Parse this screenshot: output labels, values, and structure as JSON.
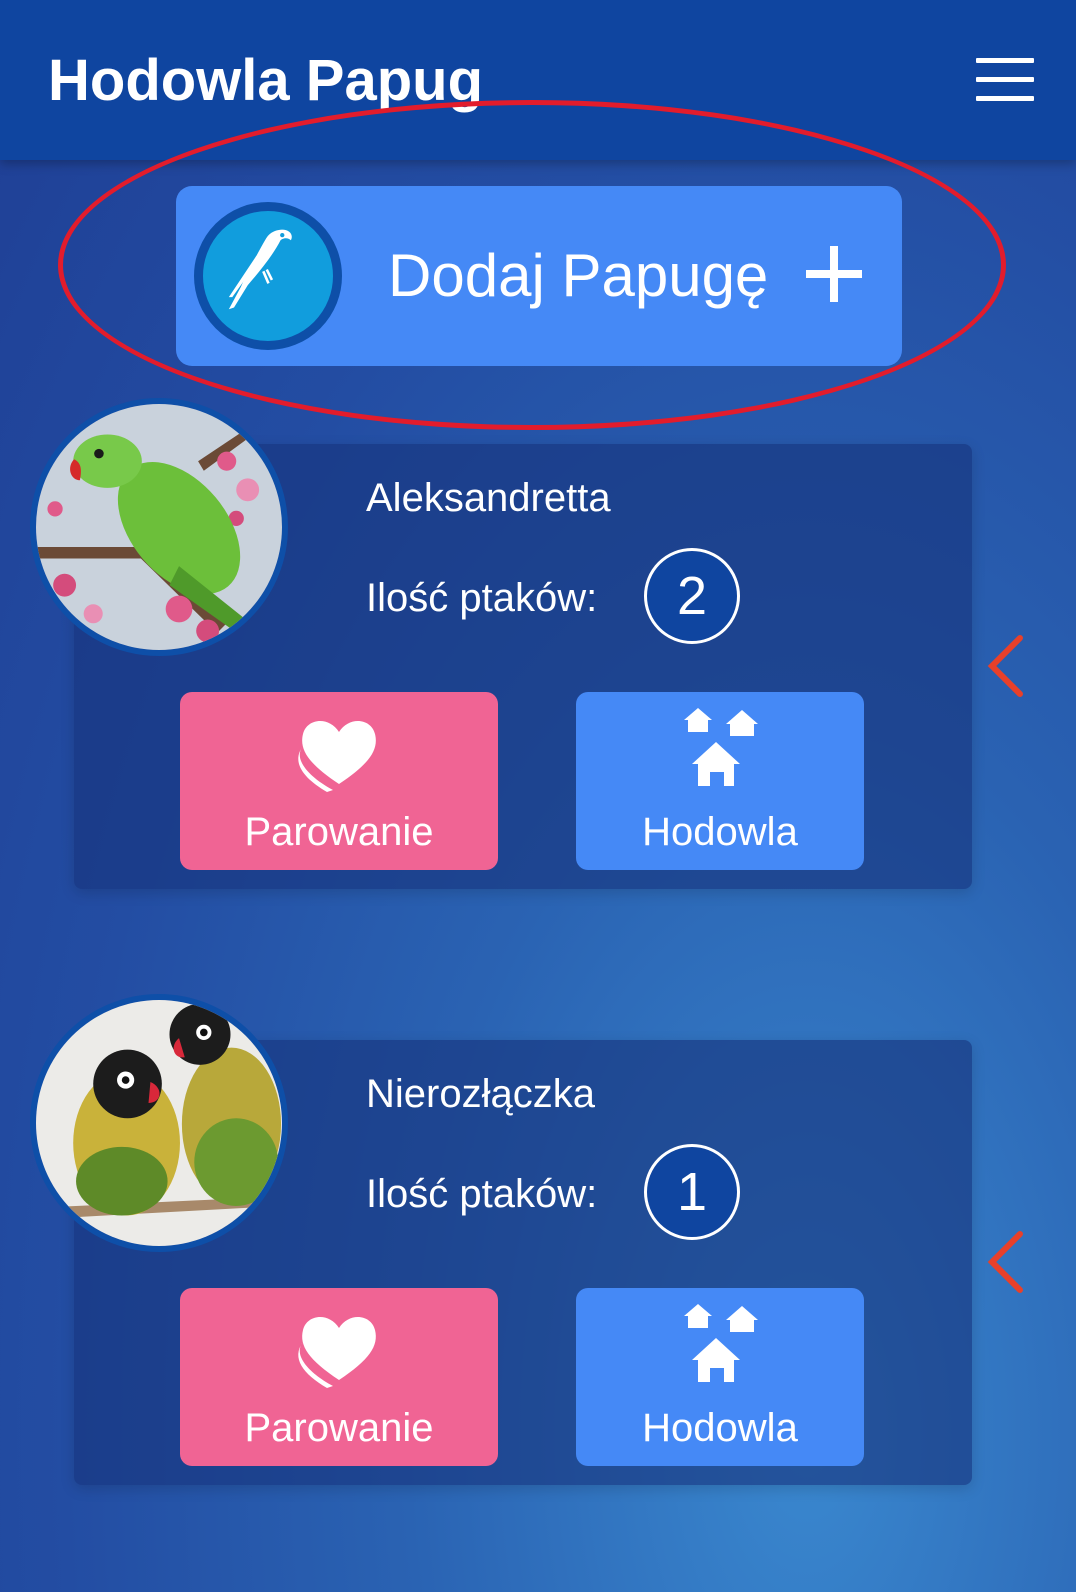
{
  "header": {
    "title": "Hodowla Papug"
  },
  "add_button": {
    "label": "Dodaj Papugę"
  },
  "species": [
    {
      "name": "Aleksandretta",
      "count_label": "Ilość ptaków:",
      "count": "2",
      "pair_label": "Parowanie",
      "farm_label": "Hodowla"
    },
    {
      "name": "Nierozłączka",
      "count_label": "Ilość ptaków:",
      "count": "1",
      "pair_label": "Parowanie",
      "farm_label": "Hodowla"
    }
  ],
  "colors": {
    "header": "#0f45a0",
    "primary_button": "#4589f6",
    "pair_button": "#f06494",
    "highlight": "#e21c2c",
    "chevron": "#e8402a"
  }
}
